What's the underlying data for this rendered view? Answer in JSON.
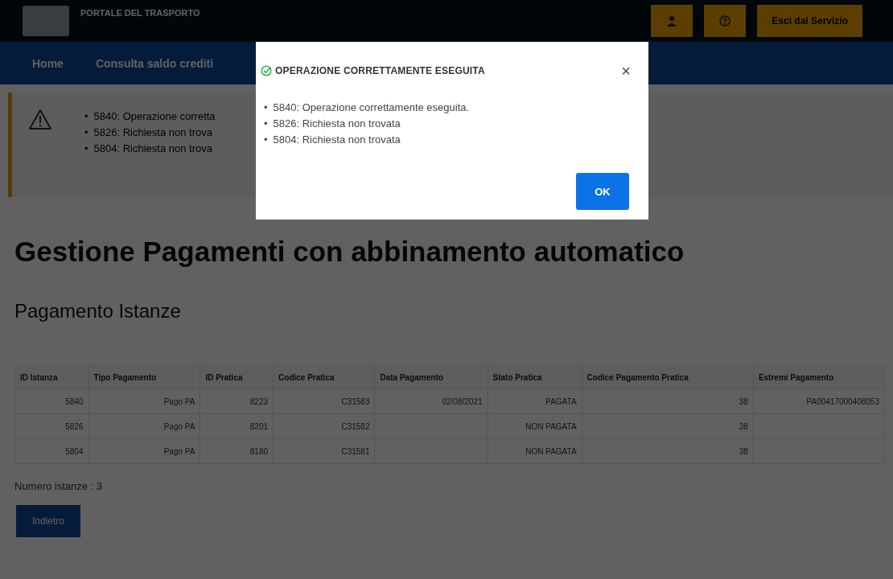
{
  "header": {
    "title": "PORTALE DEL TRASPORTO",
    "buttons": [
      {
        "kind": "user"
      },
      {
        "kind": "help"
      }
    ],
    "logout": "Esci dal Servizio"
  },
  "nav": {
    "items": [
      {
        "label": "Home"
      },
      {
        "label": "Consulta saldo crediti"
      }
    ]
  },
  "alert": {
    "items": [
      {
        "bullet": "•",
        "text": "5840: Operazione corretta"
      },
      {
        "bullet": "•",
        "text": "5826: Richiesta non trova"
      },
      {
        "bullet": "•",
        "text": "5804: Richiesta non trova"
      }
    ]
  },
  "page_title": "Gestione Pagamenti con abbinamento automatico",
  "section_title": "Pagamento Istanze",
  "table": {
    "columns": [
      "ID Istanza",
      "Tipo Pagamento",
      "ID Pratica",
      "Codice Pratica",
      "Data Pagamento",
      "Stato Pratica",
      "Codice Pagamento Pratica",
      "Estremi Pagamento"
    ],
    "rows": [
      [
        "5840",
        "Pago PA",
        "8223",
        "C31583",
        "02/08/2021",
        "PAGATA",
        "38",
        "PA00417000408053"
      ],
      [
        "5826",
        "Pago PA",
        "8201",
        "C31582",
        "",
        "NON PAGATA",
        "38",
        ""
      ],
      [
        "5804",
        "Pago PA",
        "8180",
        "C31581",
        "",
        "NON PAGATA",
        "38",
        ""
      ]
    ]
  },
  "count": "Numero istanze : 3",
  "back_button": "Indietro",
  "modal": {
    "title": "OPERAZIONE CORRETTAMENTE ESEGUITA",
    "items": [
      {
        "bullet": "•",
        "text": "5840: Operazione correttamente eseguita."
      },
      {
        "bullet": "•",
        "text": "5826: Richiesta non trovata"
      },
      {
        "bullet": "•",
        "text": "5804: Richiesta non trovata"
      }
    ],
    "close": "×",
    "ok": "OK"
  }
}
